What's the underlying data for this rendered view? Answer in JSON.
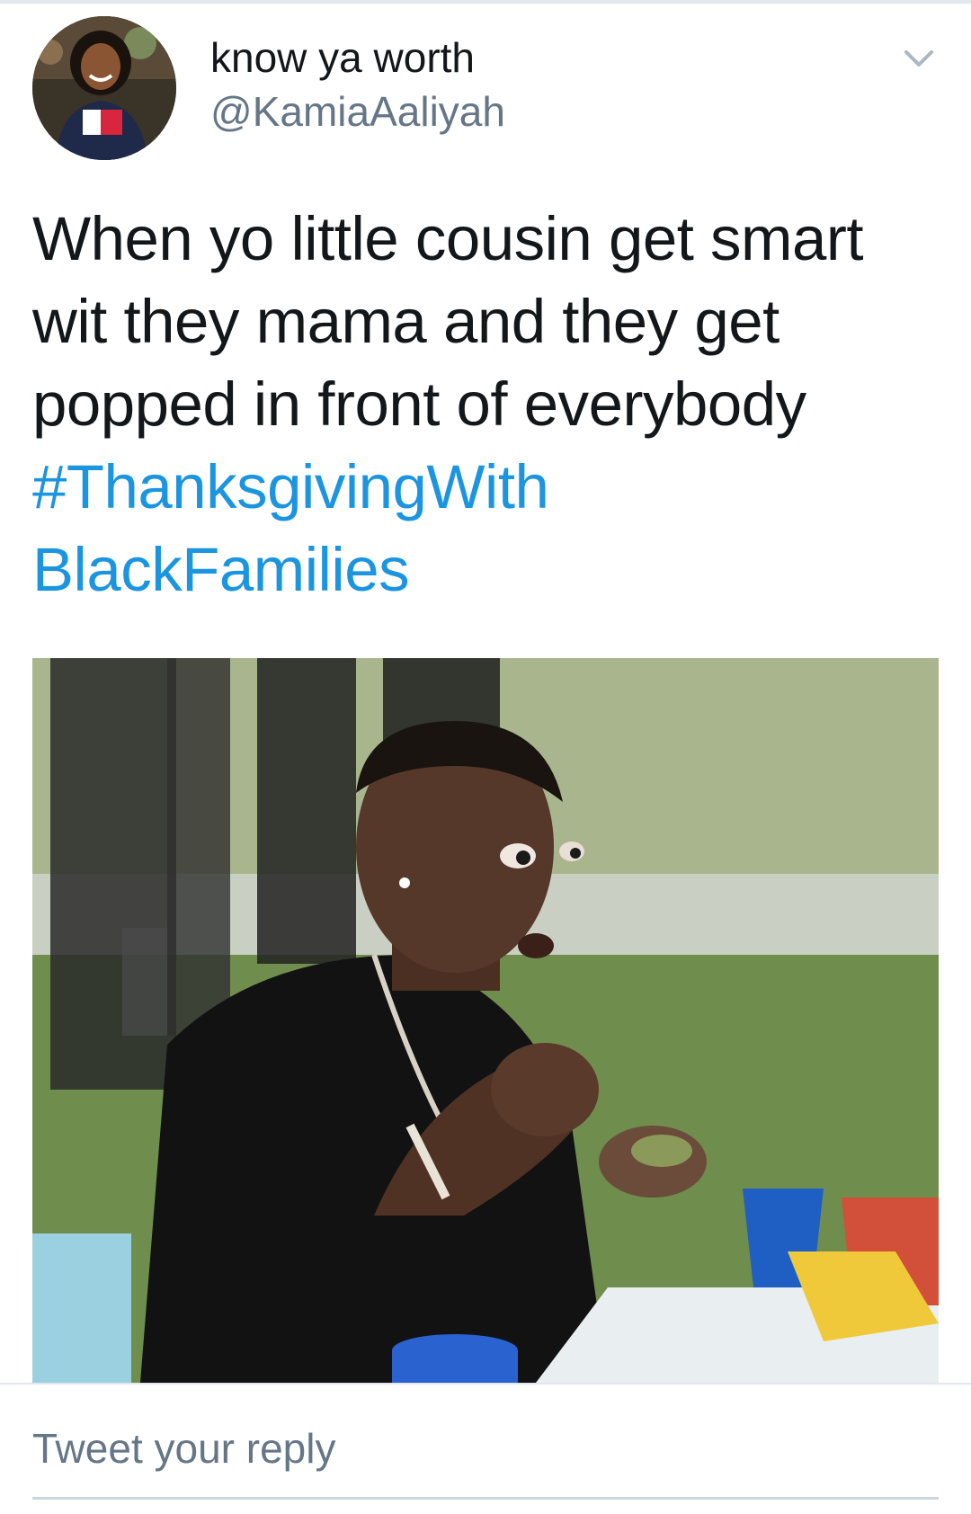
{
  "tweet": {
    "author": {
      "display_name": "know ya worth",
      "handle": "@KamiaAaliyah",
      "avatar_icon": "profile-photo"
    },
    "menu_icon": "chevron-down-icon",
    "text_plain": "When yo little cousin get smart wit they mama and they get popped in front of everybody ",
    "hashtag": "#ThanksgivingWithBlackFamilies",
    "hashtag_line1": "#ThanksgivingWith",
    "hashtag_line2": "BlackFamilies",
    "media_type": "gif-image"
  },
  "reply": {
    "placeholder": "Tweet your reply"
  },
  "colors": {
    "text": "#14171a",
    "secondary": "#657786",
    "link": "#1b95e0",
    "divider": "#e1e8ed"
  }
}
